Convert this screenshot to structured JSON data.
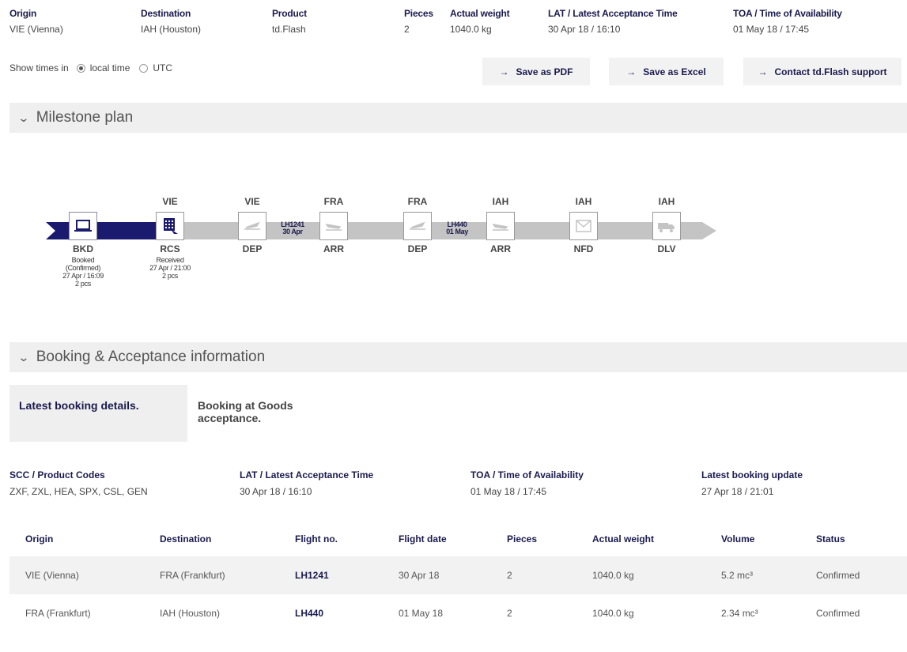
{
  "summary": {
    "origin": {
      "label": "Origin",
      "value": "VIE (Vienna)"
    },
    "destination": {
      "label": "Destination",
      "value": "IAH (Houston)"
    },
    "product": {
      "label": "Product",
      "value": "td.Flash"
    },
    "pieces": {
      "label": "Pieces",
      "value": "2"
    },
    "weight": {
      "label": "Actual weight",
      "value": "1040.0 kg"
    },
    "lat": {
      "label": "LAT / Latest Acceptance Time",
      "value": "30 Apr 18 / 16:10"
    },
    "toa": {
      "label": "TOA / Time of Availability",
      "value": "01 May 18 / 17:45"
    }
  },
  "times": {
    "label": "Show times in",
    "options": [
      "local time",
      "UTC"
    ],
    "selected": "local time"
  },
  "actions": {
    "save_pdf": "Save as PDF",
    "save_excel": "Save as Excel",
    "contact": "Contact td.Flash support",
    "arrow": "→"
  },
  "milestone": {
    "section_title": "Milestone plan",
    "chevron": "⌄",
    "colors": {
      "done": "#1a1a6e",
      "pending": "#c4c4c4"
    },
    "nodes": [
      {
        "top": "",
        "code": "BKD",
        "icon": "laptop-icon",
        "status": "Booked",
        "detail": "(Confirmed)",
        "time": "27 Apr / 16:09",
        "pcs": "2 pcs"
      },
      {
        "top": "VIE",
        "code": "RCS",
        "icon": "warehouse-icon",
        "status": "Received",
        "detail": "",
        "time": "27 Apr / 21:00",
        "pcs": "2 pcs"
      },
      {
        "top": "VIE",
        "code": "DEP",
        "icon": "plane-depart-icon"
      },
      {
        "top": "FRA",
        "code": "ARR",
        "icon": "plane-arrive-icon"
      },
      {
        "top": "FRA",
        "code": "DEP",
        "icon": "plane-depart-icon"
      },
      {
        "top": "IAH",
        "code": "ARR",
        "icon": "plane-arrive-icon"
      },
      {
        "top": "IAH",
        "code": "NFD",
        "icon": "envelope-icon"
      },
      {
        "top": "IAH",
        "code": "DLV",
        "icon": "truck-icon"
      }
    ],
    "flights": [
      {
        "no": "LH1241",
        "date": "30 Apr"
      },
      {
        "no": "LH440",
        "date": "01 May"
      }
    ]
  },
  "booking": {
    "section_title": "Booking & Acceptance information",
    "tabs": [
      "Latest booking details.",
      "Booking at Goods acceptance."
    ],
    "info": {
      "scc": {
        "label": "SCC / Product Codes",
        "value": "ZXF, ZXL, HEA, SPX, CSL, GEN"
      },
      "lat": {
        "label": "LAT / Latest Acceptance Time",
        "value": "30 Apr 18 / 16:10"
      },
      "toa": {
        "label": "TOA / Time of Availability",
        "value": "01 May 18 / 17:45"
      },
      "update": {
        "label": "Latest booking update",
        "value": "27 Apr 18 / 21:01"
      }
    },
    "table": {
      "headers": [
        "Origin",
        "Destination",
        "Flight no.",
        "Flight date",
        "Pieces",
        "Actual weight",
        "Volume",
        "Status"
      ],
      "rows": [
        [
          "VIE (Vienna)",
          "FRA (Frankfurt)",
          "LH1241",
          "30 Apr 18",
          "2",
          "1040.0 kg",
          "5.2 mc³",
          "Confirmed"
        ],
        [
          "FRA (Frankfurt)",
          "IAH (Houston)",
          "LH440",
          "01 May 18",
          "2",
          "1040.0 kg",
          "2.34 mc³",
          "Confirmed"
        ]
      ]
    }
  }
}
